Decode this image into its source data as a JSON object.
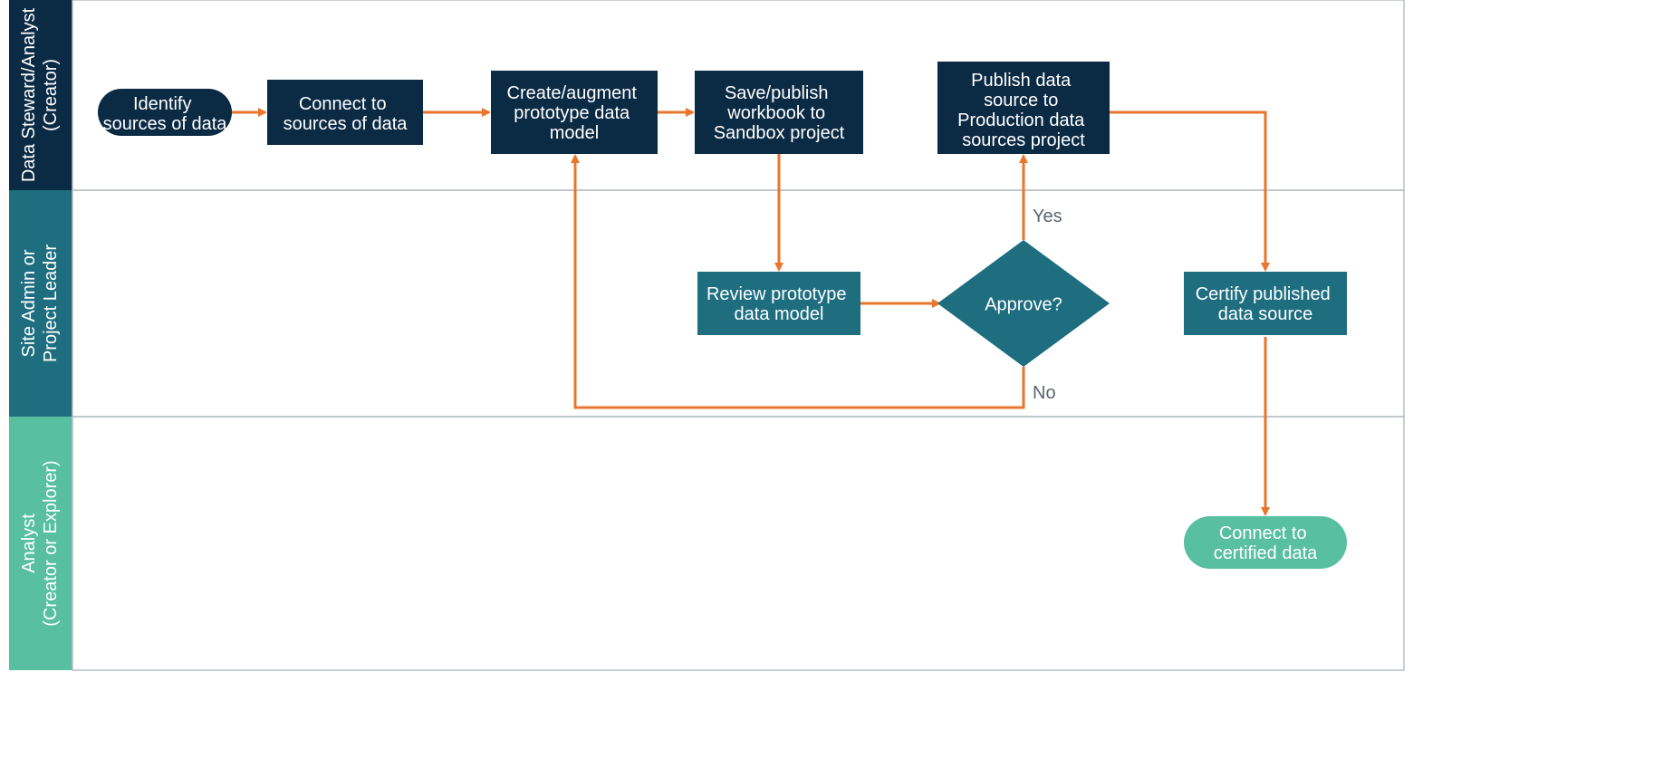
{
  "lanes": {
    "creator": {
      "line1": "Data Steward/Analyst",
      "line2": "(Creator)"
    },
    "leader": {
      "line1": "Site Admin or",
      "line2": "Project Leader"
    },
    "analyst": {
      "line1": "Analyst",
      "line2": "(Creator or Explorer)"
    }
  },
  "nodes": {
    "identify": "Identify sources of data",
    "connect": "Connect to sources of data",
    "create": "Create/augment prototype data model",
    "save": "Save/publish workbook to Sandbox project",
    "publish": "Publish data source to Production data sources project",
    "review": "Review prototype data model",
    "approve": "Approve?",
    "certify": "Certify published data source",
    "connectCert": "Connect to certified data"
  },
  "labels": {
    "yes": "Yes",
    "no": "No"
  },
  "colors": {
    "laneCreator": "#0b2a44",
    "laneLeader": "#1f6e80",
    "laneAnalyst": "#58bfa1",
    "nodeCreator": "#0b2a44",
    "nodeLeader": "#1f6e80",
    "nodeAnalyst": "#58bfa1",
    "arrow": "#e8762c",
    "laneBorder": "#b7bfc6"
  }
}
